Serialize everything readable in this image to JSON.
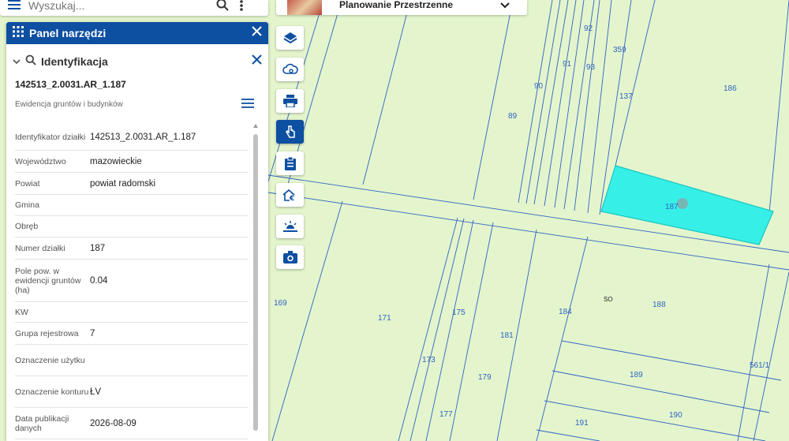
{
  "search": {
    "placeholder": "Wyszukaj..."
  },
  "topic": {
    "label": "Planowanie Przestrzenne"
  },
  "panel": {
    "title": "Panel narzędzi"
  },
  "identification": {
    "title": "Identyfikacja",
    "object_id": "142513_2.0031.AR_1.187",
    "object_subtitle": "Ewidencja gruntów i budynków",
    "attributes": [
      {
        "label": "Identyfikator działki",
        "value": "142513_2.0031.AR_1.187"
      },
      {
        "label": "Województwo",
        "value": "mazowieckie"
      },
      {
        "label": "Powiat",
        "value": "powiat radomski"
      },
      {
        "label": "Gmina",
        "value": ""
      },
      {
        "label": "Obręb",
        "value": ""
      },
      {
        "label": "Numer działki",
        "value": "187"
      },
      {
        "label": "Pole pow. w ewidencji gruntów (ha)",
        "value": "0.04"
      },
      {
        "label": "KW",
        "value": ""
      },
      {
        "label": "Grupa rejestrowa",
        "value": "7"
      },
      {
        "label": "Oznaczenie użytku",
        "value": ""
      },
      {
        "label": "Oznaczenie konturu",
        "value": "ŁV"
      },
      {
        "label": "Data publikacji danych",
        "value": "2026-08-09"
      }
    ]
  },
  "toolbar": [
    {
      "icon": "layers-icon"
    },
    {
      "icon": "cloud-search-icon"
    },
    {
      "icon": "print-icon"
    },
    {
      "icon": "identify-hand-icon",
      "active": true
    },
    {
      "icon": "clipboard-icon"
    },
    {
      "icon": "home-euro-icon"
    },
    {
      "icon": "sunrise-icon"
    },
    {
      "icon": "camera-icon"
    }
  ],
  "map_labels": {
    "l92": "92",
    "l359": "359",
    "l91": "91",
    "l93": "93",
    "l90": "90",
    "l186": "186",
    "l137": "137",
    "l89": "89",
    "l187": "187",
    "l169": "169",
    "l171": "171",
    "l175": "175",
    "l184": "184",
    "l188": "188",
    "l181": "181",
    "l173": "173",
    "l179": "179",
    "l189": "189",
    "l5611": "561/1",
    "l177": "177",
    "l190": "190",
    "l191": "191",
    "so": "SO"
  },
  "colors": {
    "panel_header": "#0d4fa1",
    "map_bg": "#e4f5cd",
    "parcel_line": "#2f63c2",
    "selected_parcel": "#36f0e8"
  }
}
